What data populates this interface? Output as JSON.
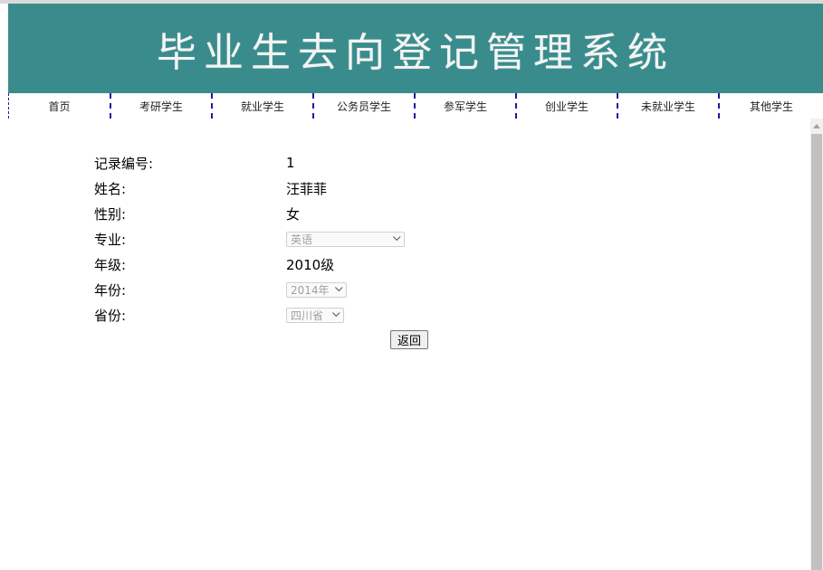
{
  "header": {
    "title": "毕业生去向登记管理系统"
  },
  "nav": {
    "items": [
      {
        "label": "首页"
      },
      {
        "label": "考研学生"
      },
      {
        "label": "就业学生"
      },
      {
        "label": "公务员学生"
      },
      {
        "label": "参军学生"
      },
      {
        "label": "创业学生"
      },
      {
        "label": "未就业学生"
      },
      {
        "label": "其他学生"
      }
    ]
  },
  "record": {
    "id": {
      "label": "记录编号:",
      "value": "1"
    },
    "name": {
      "label": "姓名:",
      "value": "汪菲菲"
    },
    "gender": {
      "label": "性别:",
      "value": "女"
    },
    "major": {
      "label": "专业:",
      "selected": "英语"
    },
    "grade": {
      "label": "年级:",
      "value": "2010级"
    },
    "year": {
      "label": "年份:",
      "selected": "2014年"
    },
    "province": {
      "label": "省份:",
      "selected": "四川省"
    }
  },
  "actions": {
    "back_label": "返回"
  },
  "colors": {
    "banner": "#3a8c8c",
    "nav_divider": "#1a1aa6"
  }
}
